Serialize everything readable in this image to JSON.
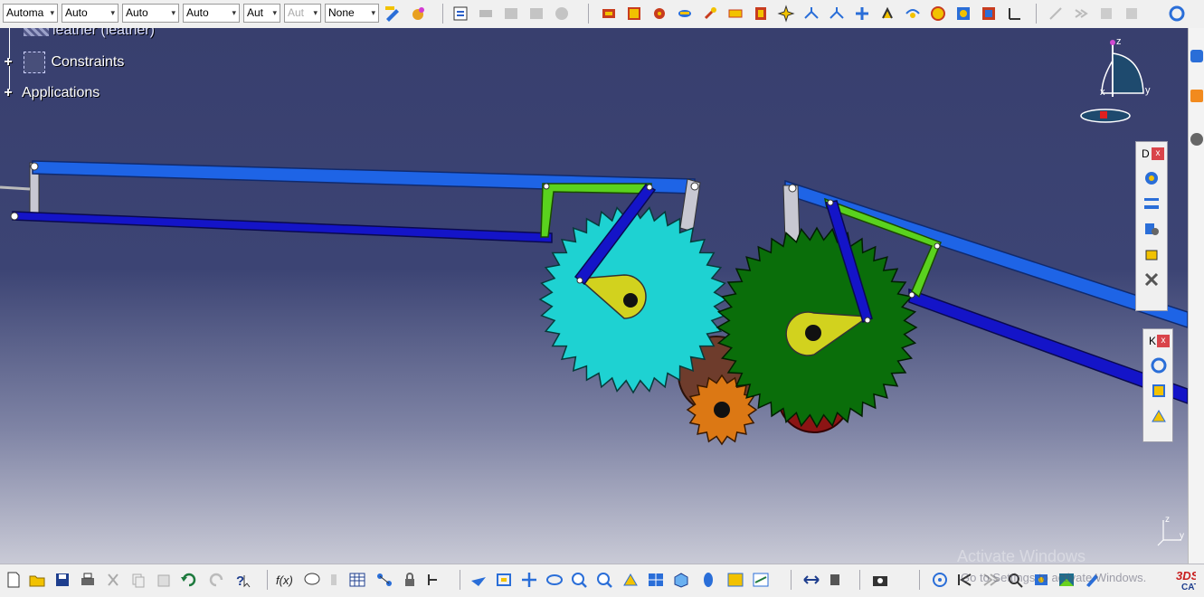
{
  "top_toolbar": {
    "combos": [
      {
        "name": "color-combo",
        "value": "Automa",
        "disabled": false
      },
      {
        "name": "transparency-combo",
        "value": "Auto",
        "disabled": false
      },
      {
        "name": "line-thickness-combo",
        "value": "Auto",
        "disabled": false
      },
      {
        "name": "linetype-combo",
        "value": "Auto",
        "disabled": false
      },
      {
        "name": "point-type-combo",
        "value": "Aut",
        "disabled": false
      },
      {
        "name": "rendering-combo",
        "value": "Aut",
        "disabled": true
      },
      {
        "name": "layer-combo",
        "value": "None",
        "disabled": false
      }
    ]
  },
  "tree": {
    "items": [
      {
        "label": "leather (leather)"
      },
      {
        "label": "Constraints"
      },
      {
        "label": "Applications"
      }
    ]
  },
  "compass": {
    "z": "z",
    "x": "x",
    "y": "y"
  },
  "axis_small": {
    "z": "z",
    "y": "y"
  },
  "palettes": {
    "d": {
      "title": "D",
      "close": "x"
    },
    "k": {
      "title": "K",
      "close": "x"
    }
  },
  "watermark": {
    "line1": "Activate Windows",
    "line2": "Go to Settings to activate Windows."
  },
  "colors": {
    "bar_blue": "#1e64e6",
    "bar_dark_blue": "#1414c8",
    "link_green": "#5ad21e",
    "gear_cyan": "#1ed2d2",
    "gear_green": "#0a6e0a",
    "gear_orange": "#dc7814",
    "gear_brown": "#6e3c2c",
    "gear_red": "#8c1414",
    "crank_yellow": "#d2d21e"
  }
}
